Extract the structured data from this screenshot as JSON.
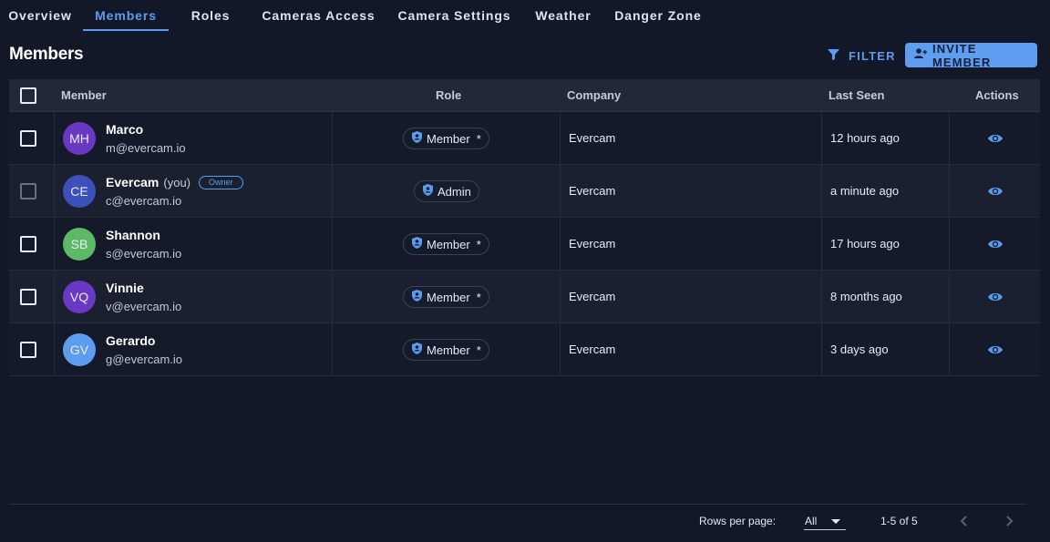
{
  "tabs": [
    {
      "label": "Overview"
    },
    {
      "label": "Members"
    },
    {
      "label": "Roles"
    },
    {
      "label": "Cameras Access"
    },
    {
      "label": "Camera Settings"
    },
    {
      "label": "Weather"
    },
    {
      "label": "Danger Zone"
    }
  ],
  "active_tab": "Members",
  "page": {
    "title": "Members"
  },
  "toolbar": {
    "filter_label": "FILTER",
    "invite_label": "INVITE MEMBER"
  },
  "table": {
    "headers": {
      "member": "Member",
      "role": "Role",
      "company": "Company",
      "last_seen": "Last Seen",
      "actions": "Actions"
    },
    "rows": [
      {
        "initials": "MH",
        "avatar_color": "#6a39c4",
        "name": "Marco",
        "you": "",
        "badge": "",
        "email": "m@evercam.io",
        "role": "Member",
        "role_asterisk": "*",
        "company": "Evercam",
        "last_seen": "12 hours ago"
      },
      {
        "initials": "CE",
        "avatar_color": "#3d4fb8",
        "name": "Evercam",
        "you": "(you)",
        "badge": "Owner",
        "email": "c@evercam.io",
        "role": "Admin",
        "role_asterisk": "",
        "company": "Evercam",
        "last_seen": "a minute ago"
      },
      {
        "initials": "SB",
        "avatar_color": "#5cba66",
        "name": "Shannon",
        "you": "",
        "badge": "",
        "email": "s@evercam.io",
        "role": "Member",
        "role_asterisk": "*",
        "company": "Evercam",
        "last_seen": "17 hours ago"
      },
      {
        "initials": "VQ",
        "avatar_color": "#6a39c4",
        "name": "Vinnie",
        "you": "",
        "badge": "",
        "email": "v@evercam.io",
        "role": "Member",
        "role_asterisk": "*",
        "company": "Evercam",
        "last_seen": "8 months ago"
      },
      {
        "initials": "GV",
        "avatar_color": "#5d9df0",
        "name": "Gerardo",
        "you": "",
        "badge": "",
        "email": "g@evercam.io",
        "role": "Member",
        "role_asterisk": "*",
        "company": "Evercam",
        "last_seen": "3 days ago"
      }
    ]
  },
  "footer": {
    "rows_per_page_label": "Rows per page:",
    "rows_per_page_value": "All",
    "range": "1-5 of 5"
  },
  "colors": {
    "accent": "#5b9cf0",
    "background": "#131828"
  },
  "icons": {
    "filter": "filter-icon",
    "invite": "add-user-icon",
    "role": "shield-user-icon",
    "view": "eye-icon",
    "prev": "chevron-left-icon",
    "next": "chevron-right-icon"
  }
}
